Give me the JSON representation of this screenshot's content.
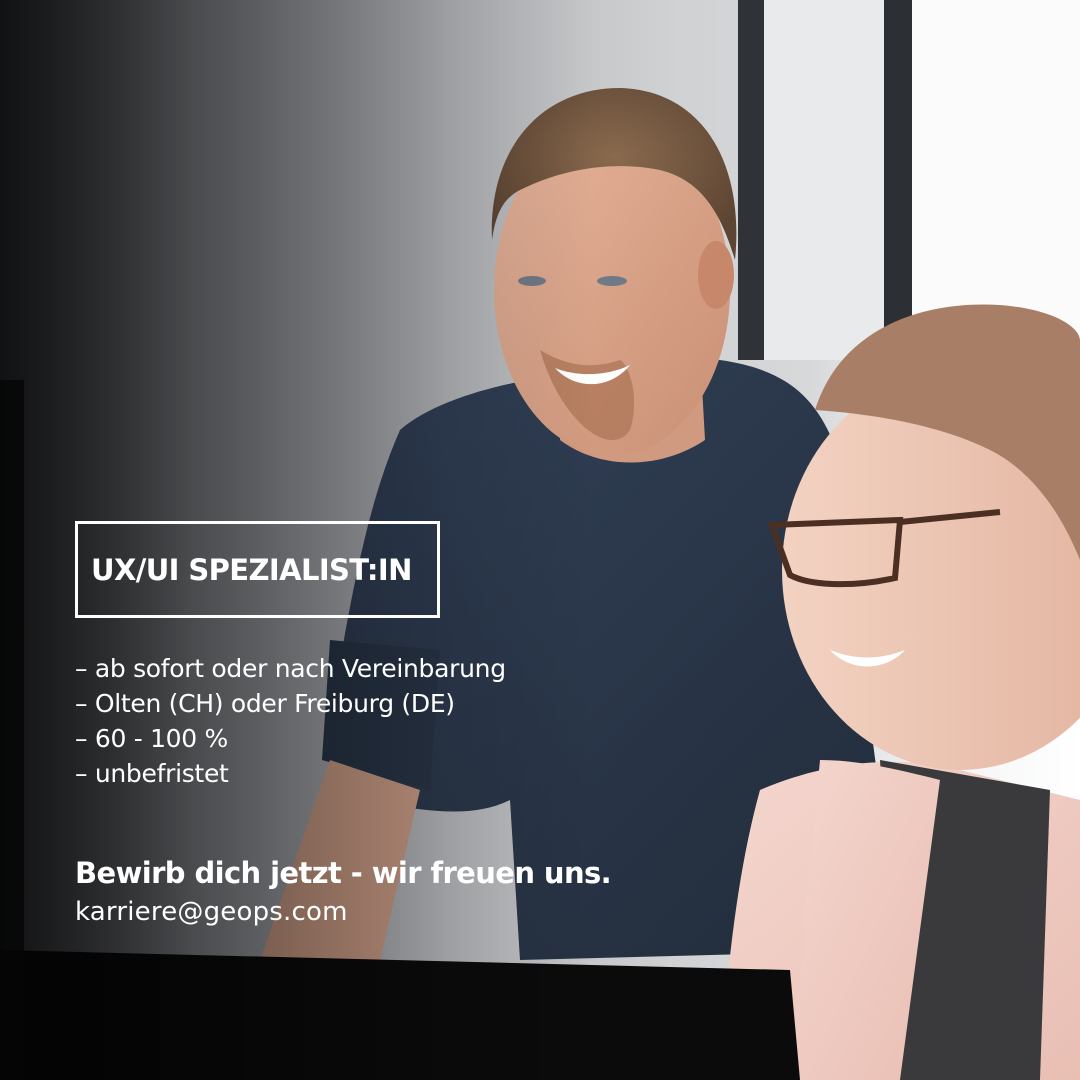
{
  "headline": "UX/UI SPEZIALIST:IN",
  "details": [
    "– ab sofort oder nach Vereinbarung",
    "– Olten (CH) oder Freiburg (DE)",
    "– 60 - 100 %",
    "– unbefristet"
  ],
  "cta": "Bewirb dich jetzt - wir freuen uns.",
  "email": "karriere@geops.com",
  "colors": {
    "text": "#ffffff",
    "sweater": "#2b3748",
    "cardigan": "#f1cfc6",
    "monitor": "#0b0b0c"
  }
}
